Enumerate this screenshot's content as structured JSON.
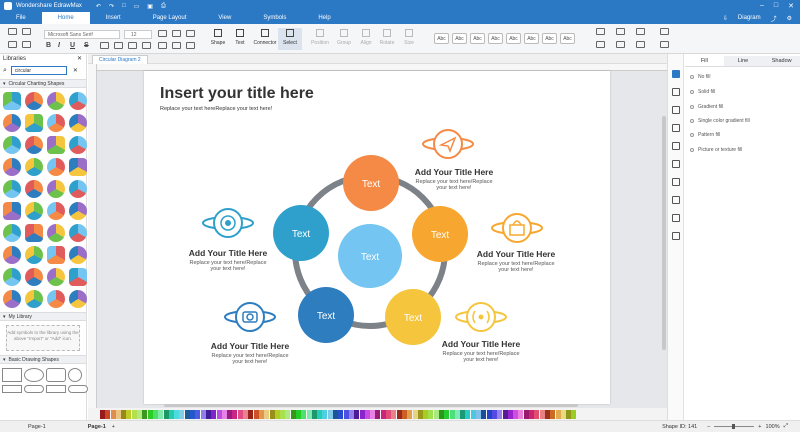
{
  "app": {
    "title": "Wondershare EdrawMax",
    "user": "Diagram",
    "menu_tabs": [
      "File",
      "Home",
      "Insert",
      "Page Layout",
      "View",
      "Symbols",
      "Help"
    ],
    "active_tab": "Home"
  },
  "toolbar": {
    "font_family": "Microsoft Sans Serif",
    "font_size": "12",
    "format_buttons": [
      "B",
      "I",
      "U",
      "S"
    ],
    "tools": [
      "Shape",
      "Text",
      "Connector",
      "Select",
      "Position",
      "Group",
      "Align",
      "Rotate",
      "Size"
    ],
    "style_swatches": [
      "Abc",
      "Abc",
      "Abc",
      "Abc",
      "Abc",
      "Abc",
      "Abc",
      "Abc"
    ]
  },
  "left_panel": {
    "title": "Libraries",
    "search_value": "circular",
    "sections": {
      "circular": "Circular Charting Shapes",
      "my_library": "My Library",
      "basic": "Basic Drawing Shapes"
    },
    "my_library_hint": "Add symbols to the library using the above \"Import\" or \"Add\" icon."
  },
  "document": {
    "tab": "Circular Diagram 2"
  },
  "diagram": {
    "title": "Insert your title here",
    "subtitle": "Replace your text hereReplace your text here!",
    "circles": [
      {
        "label": "Text",
        "color": "#f48a45"
      },
      {
        "label": "Text",
        "color": "#f7a72f"
      },
      {
        "label": "Text",
        "color": "#f5c53e"
      },
      {
        "label": "Text",
        "color": "#2e7dbf"
      },
      {
        "label": "Text",
        "color": "#2ea0cb"
      },
      {
        "label": "Text",
        "color": "#74c5f1"
      }
    ],
    "callouts": [
      {
        "heading": "Add Your Title Here",
        "body1": "Replace your text here/Replace",
        "body2": "your text here!",
        "icon": "paper-plane-icon"
      },
      {
        "heading": "Add Your Title Here",
        "body1": "Replace your text here/Replace",
        "body2": "your text here!",
        "icon": "shopping-bag-icon"
      },
      {
        "heading": "Add Your Title Here",
        "body1": "Replace your text here/Replace",
        "body2": "your text here!",
        "icon": "broadcast-icon"
      },
      {
        "heading": "Add Your Title Here",
        "body1": "Replace your text here/Replace",
        "body2": "your text here!",
        "icon": "camera-icon"
      },
      {
        "heading": "Add Your Title Here",
        "body1": "Replace your text here/Replace",
        "body2": "your text here!",
        "icon": "aperture-icon"
      }
    ]
  },
  "right_panel": {
    "tabs": [
      "Fill",
      "Line",
      "Shadow"
    ],
    "active_tab": "Fill",
    "fill_options": [
      "No fill",
      "Solid fill",
      "Gradient fill",
      "Single color gradient fill",
      "Pattern fill",
      "Picture or texture fill"
    ]
  },
  "status": {
    "page_selector": "Page-1",
    "page_tab": "Page-1",
    "shape_id": "Shape ID: 141",
    "zoom": "100%"
  },
  "colors": {
    "accent": "#2b78c5",
    "ring": "#7d8288"
  }
}
